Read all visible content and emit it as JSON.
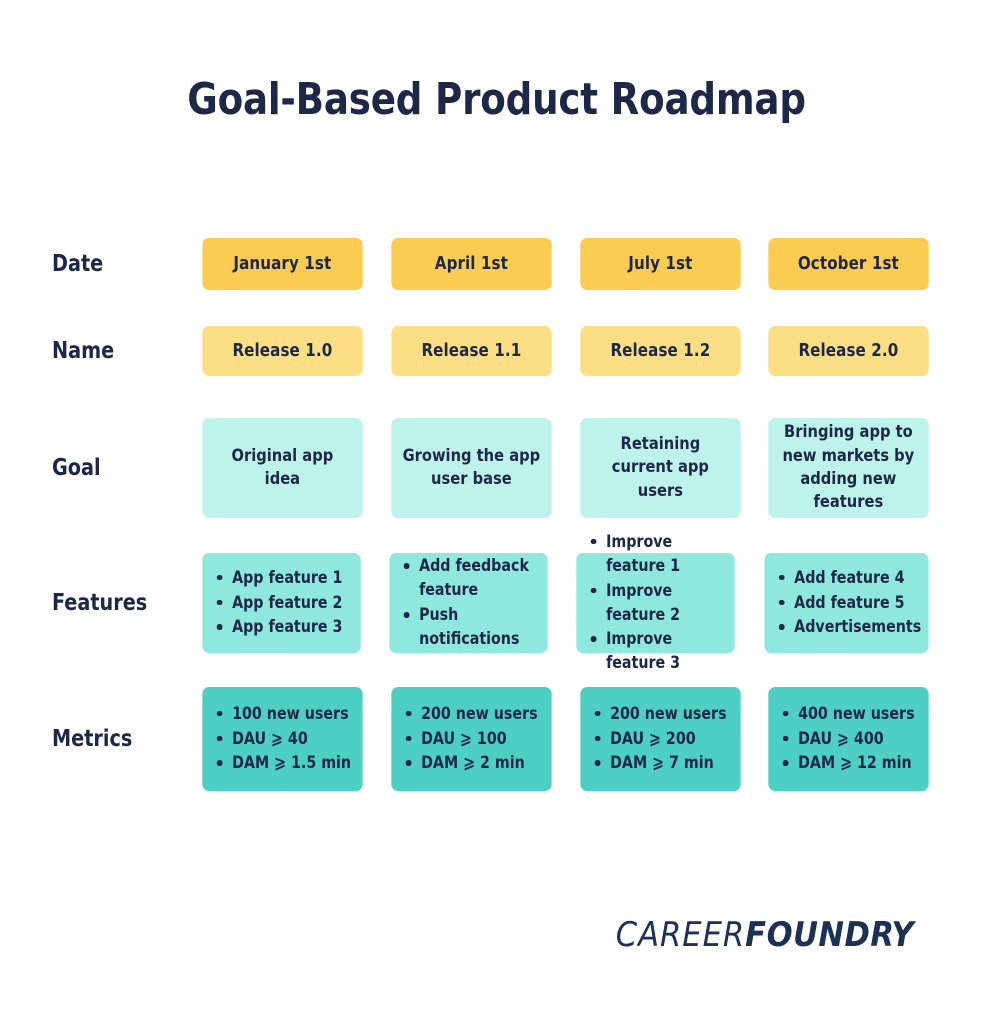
{
  "page": {
    "title": "Goal-Based Product Roadmap",
    "background_color": "#FFFFFF",
    "text_color": "#1D2747"
  },
  "logo": {
    "part1": "CAREER",
    "part2": "FOUNDRY",
    "color": "#1D3055"
  },
  "roadmap": {
    "row_labels": {
      "date": "Date",
      "name": "Name",
      "goal": "Goal",
      "features": "Features",
      "metrics": "Metrics"
    },
    "colors": {
      "date": "#FBCC51",
      "name": "#FCDF85",
      "goal": "#BDF3EB",
      "features": "#8FE8DE",
      "metrics": "#4ECFC3"
    },
    "columns": [
      {
        "date": "January 1st",
        "name": "Release 1.0",
        "goal": "Original app idea",
        "features": [
          "App feature 1",
          "App feature 2",
          "App feature 3"
        ],
        "metrics": [
          "100 new users",
          "DAU ⩾ 40",
          "DAM ⩾ 1.5 min"
        ]
      },
      {
        "date": "April 1st",
        "name": "Release 1.1",
        "goal": "Growing the app user base",
        "features": [
          "Add feedback feature",
          "Push notifications"
        ],
        "metrics": [
          "200 new users",
          "DAU ⩾ 100",
          "DAM ⩾ 2 min"
        ]
      },
      {
        "date": "July 1st",
        "name": "Release 1.2",
        "goal": "Retaining current app users",
        "features": [
          "Improve feature 1",
          "Improve feature 2",
          "Improve feature 3"
        ],
        "metrics": [
          "200 new users",
          "DAU ⩾ 200",
          "DAM ⩾ 7 min"
        ]
      },
      {
        "date": "October 1st",
        "name": "Release 2.0",
        "goal": "Bringing app to new markets by adding new features",
        "features": [
          "Add feature 4",
          "Add feature 5",
          "Advertisements"
        ],
        "metrics": [
          "400 new users",
          "DAU ⩾ 400",
          "DAM ⩾ 12 min"
        ]
      }
    ]
  }
}
